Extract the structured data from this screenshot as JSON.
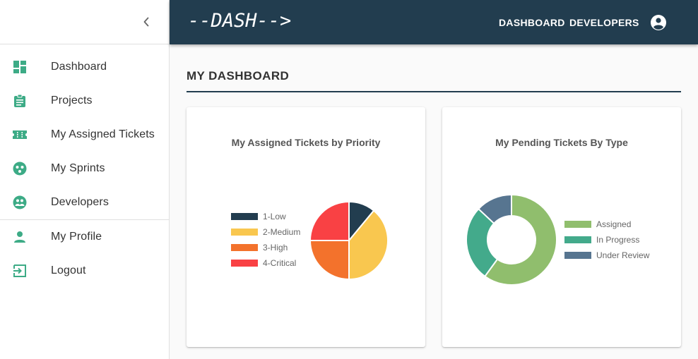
{
  "sidebar": {
    "collapse_label": "‹",
    "items_primary": [
      {
        "label": "Dashboard",
        "icon": "dashboard-icon"
      },
      {
        "label": "Projects",
        "icon": "clipboard-icon"
      },
      {
        "label": "My Assigned Tickets",
        "icon": "ticket-icon"
      },
      {
        "label": "My Sprints",
        "icon": "sprint-icon"
      },
      {
        "label": "Developers",
        "icon": "developers-icon"
      }
    ],
    "items_secondary": [
      {
        "label": "My Profile",
        "icon": "person-icon"
      },
      {
        "label": "Logout",
        "icon": "logout-icon"
      }
    ],
    "icon_color": "#3dab86"
  },
  "topbar": {
    "brand": "--DASH-->",
    "nav": {
      "dashboard": "DASHBOARD",
      "developers": "DEVELOPERS"
    },
    "background": "#223d4f"
  },
  "main": {
    "title": "MY DASHBOARD"
  },
  "chart_data": [
    {
      "type": "pie",
      "title": "My Assigned Tickets by Priority",
      "categories": [
        "1-Low",
        "2-Medium",
        "3-High",
        "4-Critical"
      ],
      "values": [
        11,
        39,
        25,
        25
      ],
      "colors": [
        "#223d4f",
        "#f9c74f",
        "#f3722c",
        "#f94144"
      ],
      "legend": "left"
    },
    {
      "type": "pie",
      "title": "My Pending Tickets By Type",
      "variant": "donut",
      "categories": [
        "Assigned",
        "In Progress",
        "Under Review"
      ],
      "values": [
        60,
        27,
        13
      ],
      "colors": [
        "#90be6d",
        "#43aa8b",
        "#577590"
      ],
      "legend": "right"
    }
  ]
}
